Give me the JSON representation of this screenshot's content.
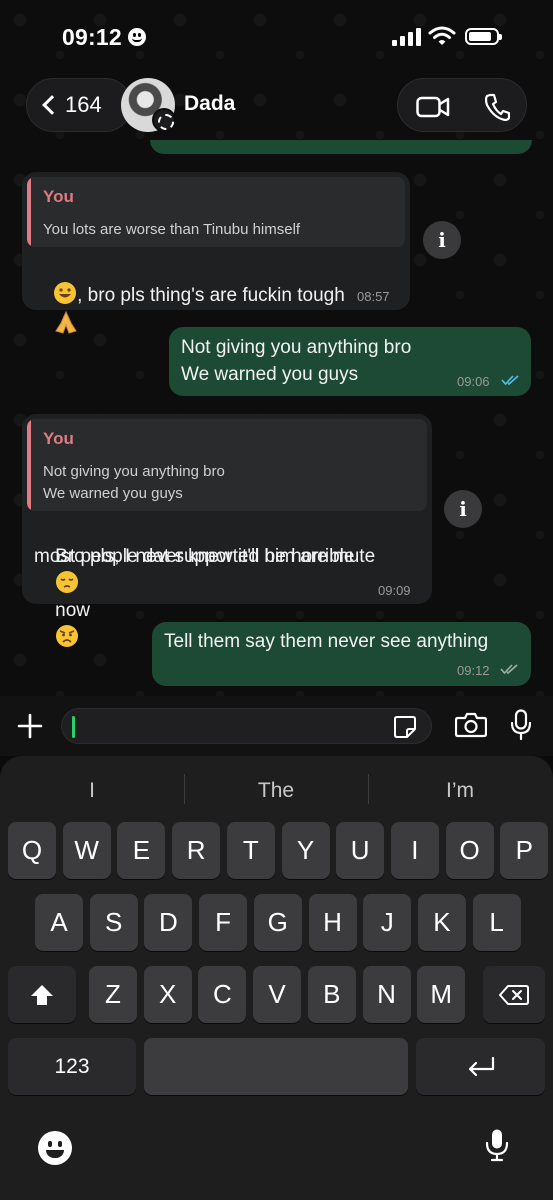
{
  "status_bar": {
    "time": "09:12"
  },
  "header": {
    "back_count": "164",
    "contact_name": "Dada"
  },
  "messages": [
    {
      "direction": "incoming",
      "quote_author": "You",
      "quote_lines": [
        "You lots are worse than Tinubu himself"
      ],
      "text": ", bro pls thing's are fuckin tough",
      "leading_emoji": "grinning-face",
      "trailing_emoji": "folded-hands",
      "time": "08:57"
    },
    {
      "direction": "outgoing",
      "text": "Not giving you anything bro\nWe warned you guys",
      "time": "09:06",
      "read": true
    },
    {
      "direction": "incoming",
      "quote_author": "You",
      "quote_lines": [
        "Not giving you anything bro",
        "We warned you guys"
      ],
      "lines": [
        "Bro pls, I never knew it'll be horrible",
        "most people dat supported him are mute",
        "now"
      ],
      "emojis": [
        "pensive-face",
        "angry-face"
      ],
      "time": "09:09"
    },
    {
      "direction": "outgoing",
      "text": "Tell them say them never see anything",
      "time": "09:12",
      "read": false
    }
  ],
  "info_button_label": "i",
  "keyboard": {
    "suggestions": [
      "I",
      "The",
      "I’m"
    ],
    "row1": [
      "Q",
      "W",
      "E",
      "R",
      "T",
      "Y",
      "U",
      "I",
      "O",
      "P"
    ],
    "row2": [
      "A",
      "S",
      "D",
      "F",
      "G",
      "H",
      "J",
      "K",
      "L"
    ],
    "row3": [
      "Z",
      "X",
      "C",
      "V",
      "B",
      "N",
      "M"
    ],
    "numbers_label": "123"
  },
  "colors": {
    "accent": "#25d366",
    "outgoing_bubble": "#1d4a34",
    "incoming_bubble": "#1f2022",
    "quote_author": "#e07a83",
    "read_ticks": "#53bdeb"
  },
  "icons": [
    "back-chevron-icon",
    "video-call-icon",
    "voice-call-icon",
    "plus-icon",
    "sticker-icon",
    "camera-icon",
    "mic-icon",
    "shift-icon",
    "delete-icon",
    "return-icon",
    "emoji-icon",
    "dictation-icon"
  ]
}
